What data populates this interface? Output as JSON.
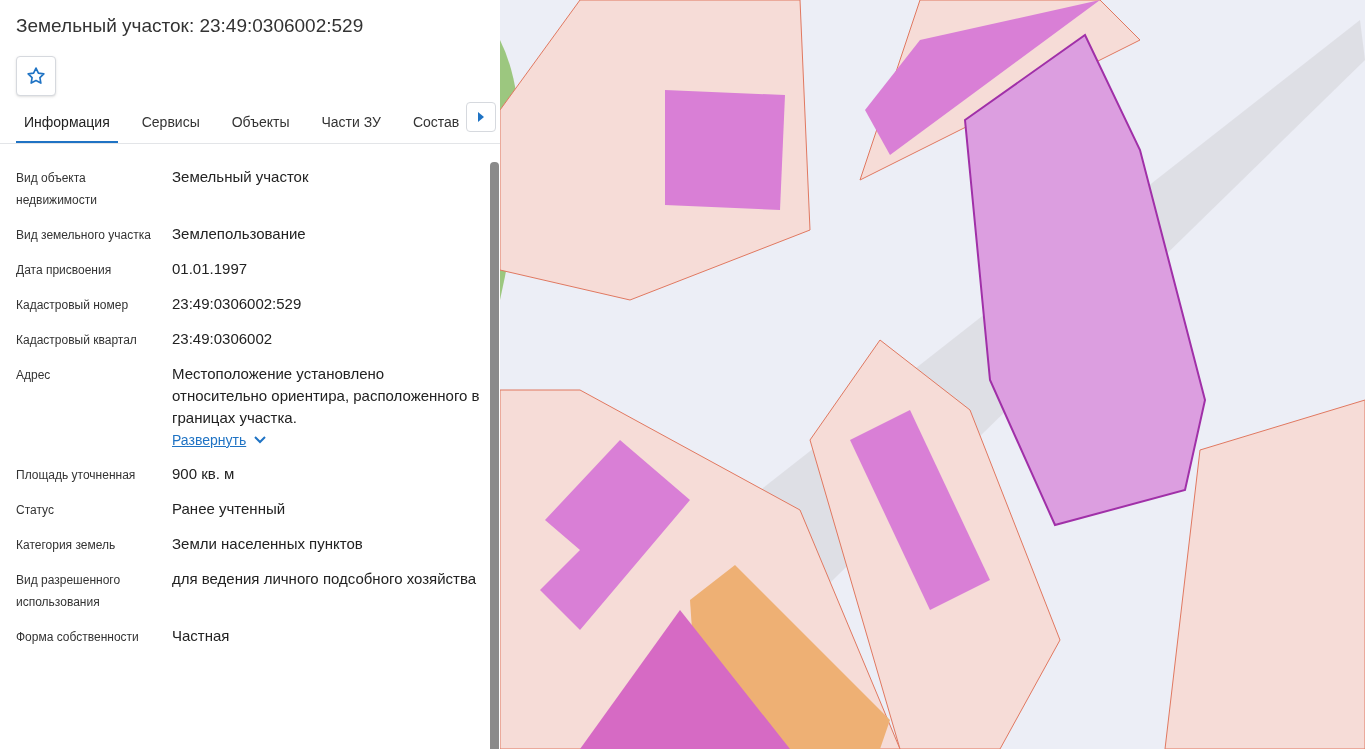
{
  "title": "Земельный участок: 23:49:0306002:529",
  "favorite": {
    "selected": false
  },
  "tabs": [
    {
      "label": "Информация",
      "selected": true
    },
    {
      "label": "Сервисы",
      "selected": false
    },
    {
      "label": "Объекты",
      "selected": false
    },
    {
      "label": "Части ЗУ",
      "selected": false
    },
    {
      "label": "Состав",
      "selected": false
    }
  ],
  "fields": [
    {
      "label": "Вид объекта недвижимости",
      "value": "Земельный участок"
    },
    {
      "label": "Вид земельного участка",
      "value": "Землепользование"
    },
    {
      "label": "Дата присвоения",
      "value": "01.01.1997"
    },
    {
      "label": "Кадастровый номер",
      "value": "23:49:0306002:529"
    },
    {
      "label": "Кадастровый квартал",
      "value": "23:49:0306002"
    },
    {
      "label": "Адрес",
      "value": "Местоположение установлено относительно ориентира, расположенного в границах участка.",
      "expand_link": {
        "label": "Развернуть",
        "expanded": false
      }
    },
    {
      "label": "Площадь уточненная",
      "value": "900 кв. м"
    },
    {
      "label": "Статус",
      "value": "Ранее учтенный"
    },
    {
      "label": "Категория земель",
      "value": "Земли населенных пунктов"
    },
    {
      "label": "Вид разрешенного использования",
      "value": "для ведения личного подсобного хозяйства"
    },
    {
      "label": "Форма собственности",
      "value": "Частная"
    }
  ]
}
